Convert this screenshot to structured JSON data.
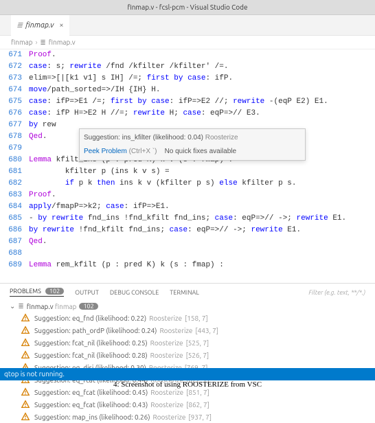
{
  "titlebar": "finmap.v - fcsl-pcm - Visual Studio Code",
  "tab": {
    "name": "finmap.v",
    "icon": "≣"
  },
  "breadcrumbs": {
    "folder": "finmap",
    "file": "finmap.v",
    "icon": "≣"
  },
  "lines": [
    {
      "no": "671",
      "segs": [
        [
          "cmd",
          "Proof"
        ],
        [
          "",
          "."
        ]
      ]
    },
    {
      "no": "672",
      "segs": [
        [
          "kw",
          "case"
        ],
        [
          "",
          ": s; "
        ],
        [
          "kw",
          "rewrite"
        ],
        [
          "",
          " /fnd /kfilter /kfilter' /=."
        ]
      ]
    },
    {
      "no": "673",
      "segs": [
        [
          "",
          "elim=>[|[k1 v1] s IH] /=; "
        ],
        [
          "kw",
          "first by"
        ],
        [
          "",
          " "
        ],
        [
          "kw",
          "case"
        ],
        [
          "",
          ": ifP."
        ]
      ]
    },
    {
      "no": "674",
      "segs": [
        [
          "kw",
          "move"
        ],
        [
          "",
          "/path_sorted=>/IH {IH} H."
        ]
      ]
    },
    {
      "no": "675",
      "segs": [
        [
          "kw",
          "case"
        ],
        [
          "",
          ": ifP=>E1 /=; "
        ],
        [
          "kw",
          "first by"
        ],
        [
          "",
          " "
        ],
        [
          "kw",
          "case"
        ],
        [
          "",
          ": ifP=>E2 //; "
        ],
        [
          "kw",
          "rewrite"
        ],
        [
          "",
          " -(eqP E2) E1."
        ]
      ]
    },
    {
      "no": "676",
      "segs": [
        [
          "kw",
          "case"
        ],
        [
          "",
          ": ifP H=>E2 H //=; "
        ],
        [
          "kw",
          "rewrite"
        ],
        [
          "",
          " H; "
        ],
        [
          "kw",
          "case"
        ],
        [
          "",
          ": eqP=>// E3."
        ]
      ]
    },
    {
      "no": "677",
      "segs": [
        [
          "kw",
          "by"
        ],
        [
          "",
          " rew"
        ]
      ]
    },
    {
      "no": "678",
      "segs": [
        [
          "cmd",
          "Qed"
        ],
        [
          "",
          "."
        ]
      ]
    },
    {
      "no": "679",
      "segs": [
        [
          "",
          ""
        ]
      ]
    },
    {
      "no": "680",
      "segs": [
        [
          "cmd",
          "Lemma"
        ],
        [
          "",
          " kfilt_ins (p : pred K) k v (s : fmap) :"
        ]
      ]
    },
    {
      "no": "681",
      "segs": [
        [
          "",
          "        kfilter p (ins k v s) ="
        ]
      ]
    },
    {
      "no": "682",
      "segs": [
        [
          "",
          "        "
        ],
        [
          "kw",
          "if"
        ],
        [
          "",
          " p k "
        ],
        [
          "kw",
          "then"
        ],
        [
          "",
          " ins k v (kfilter p s) "
        ],
        [
          "kw",
          "else"
        ],
        [
          "",
          " kfilter p s."
        ]
      ]
    },
    {
      "no": "683",
      "segs": [
        [
          "cmd",
          "Proof"
        ],
        [
          "",
          "."
        ]
      ]
    },
    {
      "no": "684",
      "segs": [
        [
          "kw",
          "apply"
        ],
        [
          "",
          "/fmapP=>k2; "
        ],
        [
          "kw",
          "case"
        ],
        [
          "",
          ": ifP=>E1."
        ]
      ]
    },
    {
      "no": "685",
      "segs": [
        [
          "dash",
          "- "
        ],
        [
          "kw",
          "by"
        ],
        [
          "",
          " "
        ],
        [
          "kw",
          "rewrite"
        ],
        [
          "",
          " fnd_ins !fnd_kfilt fnd_ins; "
        ],
        [
          "kw",
          "case"
        ],
        [
          "",
          ": eqP=>// ->; "
        ],
        [
          "kw",
          "rewrite"
        ],
        [
          "",
          " E1."
        ]
      ]
    },
    {
      "no": "686",
      "segs": [
        [
          "kw",
          "by"
        ],
        [
          "",
          " "
        ],
        [
          "kw",
          "rewrite"
        ],
        [
          "",
          " !fnd_kfilt fnd_ins; "
        ],
        [
          "kw",
          "case"
        ],
        [
          "",
          ": eqP=>// ->; "
        ],
        [
          "kw",
          "rewrite"
        ],
        [
          "",
          " E1."
        ]
      ]
    },
    {
      "no": "687",
      "segs": [
        [
          "cmd",
          "Qed"
        ],
        [
          "",
          "."
        ]
      ]
    },
    {
      "no": "688",
      "segs": [
        [
          "",
          ""
        ]
      ]
    },
    {
      "no": "689",
      "segs": [
        [
          "cmd",
          "Lemma"
        ],
        [
          "",
          " rem_kfilt (p : pred K) k (s : fmap) :"
        ]
      ]
    }
  ],
  "hover": {
    "msg": "Suggestion: ins_kfilter (likelihood: 0.04)",
    "source": "Roosterize",
    "peek_label": "Peek Problem",
    "shortcut": "(Ctrl+X `)",
    "nofix": "No quick fixes available"
  },
  "panel": {
    "tabs": {
      "problems": "PROBLEMS",
      "output": "OUTPUT",
      "debug": "DEBUG CONSOLE",
      "terminal": "TERMINAL"
    },
    "badge": "102",
    "filter_placeholder": "Filter (e.g. text, **/*.)",
    "file_label": "finmap.v",
    "file_path": "finmap",
    "file_badge": "102"
  },
  "problems": [
    {
      "msg": "Suggestion: eq_fnd (likelihood: 0.22)",
      "src": "Roosterize",
      "loc": "[158, 7]"
    },
    {
      "msg": "Suggestion: path_ordP (likelihood: 0.24)",
      "src": "Roosterize",
      "loc": "[443, 7]"
    },
    {
      "msg": "Suggestion: fcat_nil (likelihood: 0.25)",
      "src": "Roosterize",
      "loc": "[525, 7]"
    },
    {
      "msg": "Suggestion: fcat_nil (likelihood: 0.28)",
      "src": "Roosterize",
      "loc": "[526, 7]"
    },
    {
      "msg": "Suggestion: eq_disj (likelihood: 0.30)",
      "src": "Roosterize",
      "loc": "[769, 7]"
    },
    {
      "msg": "Suggestion: eq_fcat (likelihood: 0.44)",
      "src": "Roosterize",
      "loc": "[822, 7]"
    },
    {
      "msg": "Suggestion: eq_fcat (likelihood: 0.45)",
      "src": "Roosterize",
      "loc": "[851, 7]"
    },
    {
      "msg": "Suggestion: eq_fcat (likelihood: 0.43)",
      "src": "Roosterize",
      "loc": "[862, 7]"
    },
    {
      "msg": "Suggestion: map_ins (likelihood: 0.26)",
      "src": "Roosterize",
      "loc": "[937, 7]"
    }
  ],
  "statusbar": "qtop is not running.",
  "caption": "4: Screenshot of using ROOSTERIZE from VSC"
}
